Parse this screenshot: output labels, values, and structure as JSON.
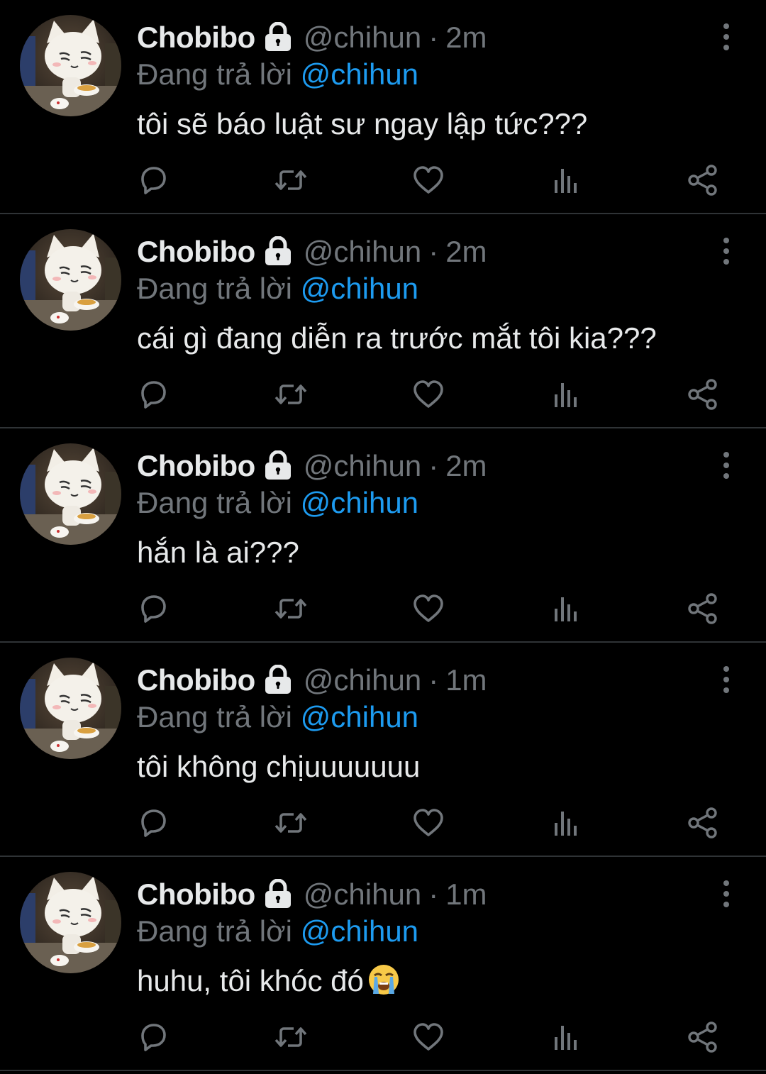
{
  "theme": {
    "background": "#000000",
    "text": "#e7e9ea",
    "muted": "#71767b",
    "link": "#1d9bf0",
    "divider": "#2f3336"
  },
  "tweets": [
    {
      "display_name": "Chobibo",
      "handle": "@chihun",
      "separator": "·",
      "time": "2m",
      "reply_prefix": "Đang trả lời",
      "reply_to": "@chihun",
      "text": "tôi sẽ báo luật sư ngay lập tức???",
      "emoji": ""
    },
    {
      "display_name": "Chobibo",
      "handle": "@chihun",
      "separator": "·",
      "time": "2m",
      "reply_prefix": "Đang trả lời",
      "reply_to": "@chihun",
      "text": "cái gì đang diễn ra trước mắt tôi kia???",
      "emoji": ""
    },
    {
      "display_name": "Chobibo",
      "handle": "@chihun",
      "separator": "·",
      "time": "2m",
      "reply_prefix": "Đang trả lời",
      "reply_to": "@chihun",
      "text": "hắn là ai???",
      "emoji": ""
    },
    {
      "display_name": "Chobibo",
      "handle": "@chihun",
      "separator": "·",
      "time": "1m",
      "reply_prefix": "Đang trả lời",
      "reply_to": "@chihun",
      "text": "tôi không chịuuuuuuu",
      "emoji": ""
    },
    {
      "display_name": "Chobibo",
      "handle": "@chihun",
      "separator": "·",
      "time": "1m",
      "reply_prefix": "Đang trả lời",
      "reply_to": "@chihun",
      "text": "huhu, tôi khóc đó",
      "emoji": "loudly-crying-face"
    }
  ],
  "icons": {
    "lock": "lock-icon",
    "more": "more-vertical-icon",
    "reply": "reply-icon",
    "retweet": "retweet-icon",
    "like": "heart-icon",
    "views": "views-icon",
    "share": "share-icon",
    "avatar": "cat-avatar"
  }
}
